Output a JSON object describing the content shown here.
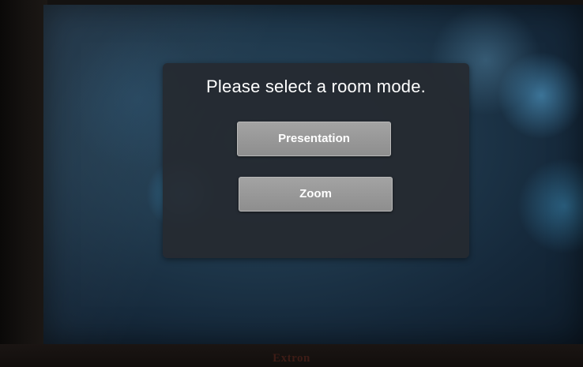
{
  "dialog": {
    "title": "Please select a room mode.",
    "buttons": [
      {
        "label": "Presentation"
      },
      {
        "label": "Zoom"
      }
    ]
  },
  "device": {
    "brand": "Extron"
  },
  "colors": {
    "dialog_background": "#262a30",
    "button_background": "#9a9a9a",
    "text": "#ffffff",
    "screen_background": "#1f3a4f"
  }
}
